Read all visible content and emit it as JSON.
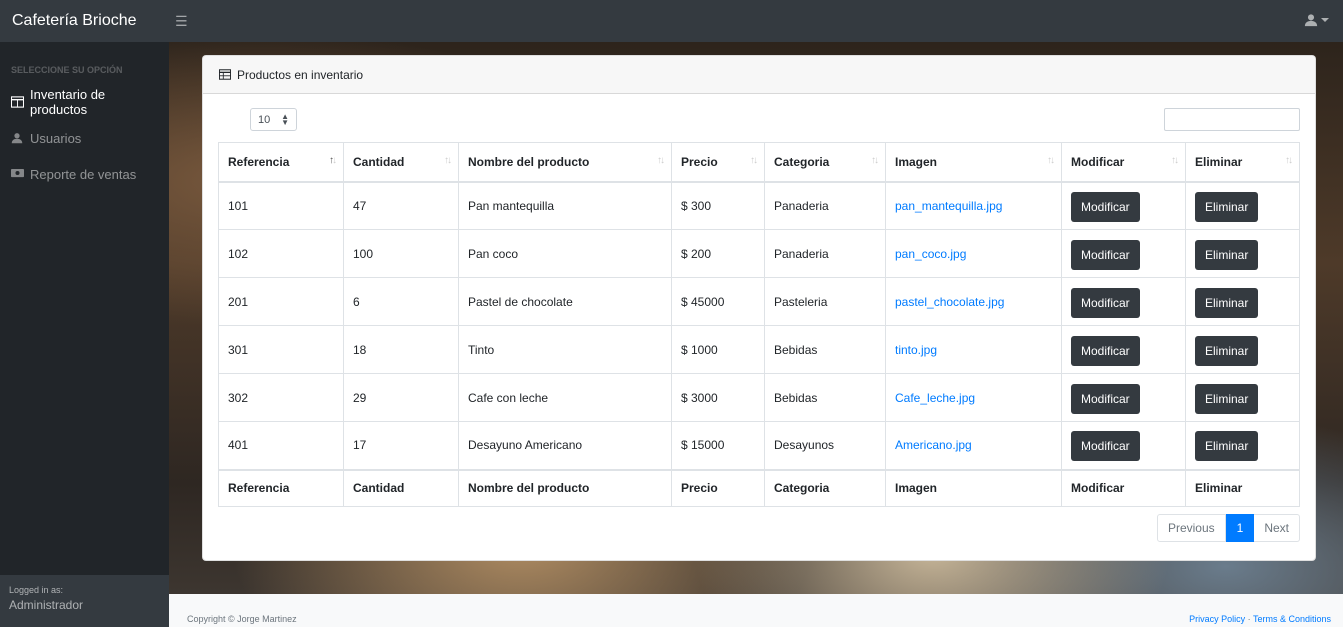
{
  "app": {
    "brand": "Cafetería Brioche"
  },
  "sidebar": {
    "heading": "SELECCIONE SU OPCIÓN",
    "items": [
      {
        "label": "Inventario de productos",
        "icon": "table-icon",
        "active": true
      },
      {
        "label": "Usuarios",
        "icon": "user-icon",
        "active": false
      },
      {
        "label": "Reporte de ventas",
        "icon": "money-icon",
        "active": false
      }
    ],
    "logged_label": "Logged in as:",
    "logged_user": "Administrador"
  },
  "card": {
    "title": "Productos en inventario",
    "page_length": "10",
    "search_value": ""
  },
  "table": {
    "columns": [
      "Referencia",
      "Cantidad",
      "Nombre del producto",
      "Precio",
      "Categoria",
      "Imagen",
      "Modificar",
      "Eliminar"
    ],
    "rows": [
      {
        "ref": "101",
        "qty": "47",
        "name": "Pan mantequilla",
        "price": "$ 300",
        "cat": "Panaderia",
        "img": "pan_mantequilla.jpg"
      },
      {
        "ref": "102",
        "qty": "100",
        "name": "Pan coco",
        "price": "$ 200",
        "cat": "Panaderia",
        "img": "pan_coco.jpg"
      },
      {
        "ref": "201",
        "qty": "6",
        "name": "Pastel de chocolate",
        "price": "$ 45000",
        "cat": "Pasteleria",
        "img": "pastel_chocolate.jpg"
      },
      {
        "ref": "301",
        "qty": "18",
        "name": "Tinto",
        "price": "$ 1000",
        "cat": "Bebidas",
        "img": "tinto.jpg"
      },
      {
        "ref": "302",
        "qty": "29",
        "name": "Cafe con leche",
        "price": "$ 3000",
        "cat": "Bebidas",
        "img": "Cafe_leche.jpg"
      },
      {
        "ref": "401",
        "qty": "17",
        "name": "Desayuno Americano",
        "price": "$ 15000",
        "cat": "Desayunos",
        "img": "Americano.jpg"
      }
    ],
    "modify_label": "Modificar",
    "delete_label": "Eliminar"
  },
  "pagination": {
    "previous": "Previous",
    "current": "1",
    "next": "Next"
  },
  "footer": {
    "copyright": "Copyright © Jorge Martinez",
    "privacy": "Privacy Policy",
    "separator": " · ",
    "terms": "Terms & Conditions"
  },
  "colors": {
    "sidebar": "#212529",
    "navbar": "#343a40",
    "link": "#007bff",
    "button": "#343a40"
  }
}
